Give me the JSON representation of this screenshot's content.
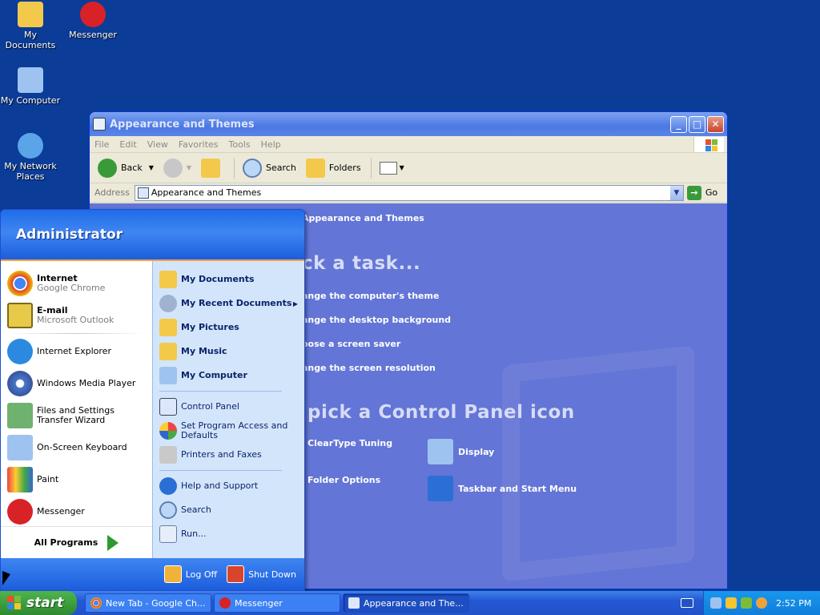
{
  "desktop": {
    "icons": [
      {
        "label": "My Documents",
        "icon": "my-documents-icon",
        "color": "#f3c94b"
      },
      {
        "label": "Messenger",
        "icon": "messenger-icon",
        "color": "#d92128"
      },
      {
        "label": "My Computer",
        "icon": "my-computer-icon",
        "color": "#9ec3f0"
      },
      {
        "label": "My Network Places",
        "icon": "network-places-icon",
        "color": "#5ba4e8"
      }
    ]
  },
  "window": {
    "title": "Appearance and Themes",
    "menu": [
      "File",
      "Edit",
      "View",
      "Favorites",
      "Tools",
      "Help"
    ],
    "toolbar": {
      "back": "Back",
      "search": "Search",
      "folders": "Folders"
    },
    "address": {
      "label": "Address",
      "value": "Appearance and Themes",
      "go": "Go"
    },
    "content": {
      "category_title": "Appearance and Themes",
      "pick_task": "ck a task...",
      "tasks": [
        "ange the computer's theme",
        "ange the desktop background",
        "oose a screen saver",
        "ange the screen resolution"
      ],
      "pick_icon": "pick a Control Panel icon",
      "icons": [
        {
          "label": "ClearType Tuning",
          "icon": "cleartype-icon"
        },
        {
          "label": "Display",
          "icon": "display-icon"
        },
        {
          "label": "Folder Options",
          "icon": "folder-options-icon"
        },
        {
          "label": "Taskbar and Start Menu",
          "icon": "taskbar-icon"
        }
      ]
    }
  },
  "start_menu": {
    "user": "Administrator",
    "pinned": [
      {
        "main": "Internet",
        "sub": "Google Chrome",
        "icon": "chrome-icon"
      },
      {
        "main": "E-mail",
        "sub": "Microsoft Outlook",
        "icon": "outlook-icon"
      }
    ],
    "recent": [
      {
        "label": "Internet Explorer",
        "icon": "internet-explorer-icon"
      },
      {
        "label": "Windows Media Player",
        "icon": "media-player-icon"
      },
      {
        "label": "Files and Settings Transfer Wizard",
        "icon": "transfer-wizard-icon"
      },
      {
        "label": "On-Screen Keyboard",
        "icon": "keyboard-icon"
      },
      {
        "label": "Paint",
        "icon": "paint-icon"
      },
      {
        "label": "Messenger",
        "icon": "messenger-icon"
      }
    ],
    "all_programs": "All Programs",
    "places": [
      {
        "label": "My Documents",
        "icon": "my-documents-icon"
      },
      {
        "label": "My Recent Documents",
        "icon": "recent-documents-icon"
      },
      {
        "label": "My Pictures",
        "icon": "my-pictures-icon"
      },
      {
        "label": "My Music",
        "icon": "my-music-icon"
      },
      {
        "label": "My Computer",
        "icon": "my-computer-icon"
      }
    ],
    "settings": [
      {
        "label": "Control Panel",
        "icon": "control-panel-icon"
      },
      {
        "label": "Set Program Access and Defaults",
        "icon": "program-access-icon"
      },
      {
        "label": "Printers and Faxes",
        "icon": "printer-icon"
      }
    ],
    "help": [
      {
        "label": "Help and Support",
        "icon": "help-icon"
      },
      {
        "label": "Search",
        "icon": "search-icon"
      },
      {
        "label": "Run...",
        "icon": "run-icon"
      }
    ],
    "log_off": "Log Off",
    "shut_down": "Shut Down"
  },
  "taskbar": {
    "start": "start",
    "tasks": [
      {
        "label": "New Tab - Google Ch...",
        "icon": "chrome-icon"
      },
      {
        "label": "Messenger",
        "icon": "messenger-icon"
      },
      {
        "label": "Appearance and The...",
        "icon": "control-panel-icon"
      }
    ],
    "clock": "2:52 PM"
  },
  "colors": {
    "desktop": "#0a3c98",
    "content_panel": "#6375d6",
    "start_green": "#3a9a3a"
  }
}
